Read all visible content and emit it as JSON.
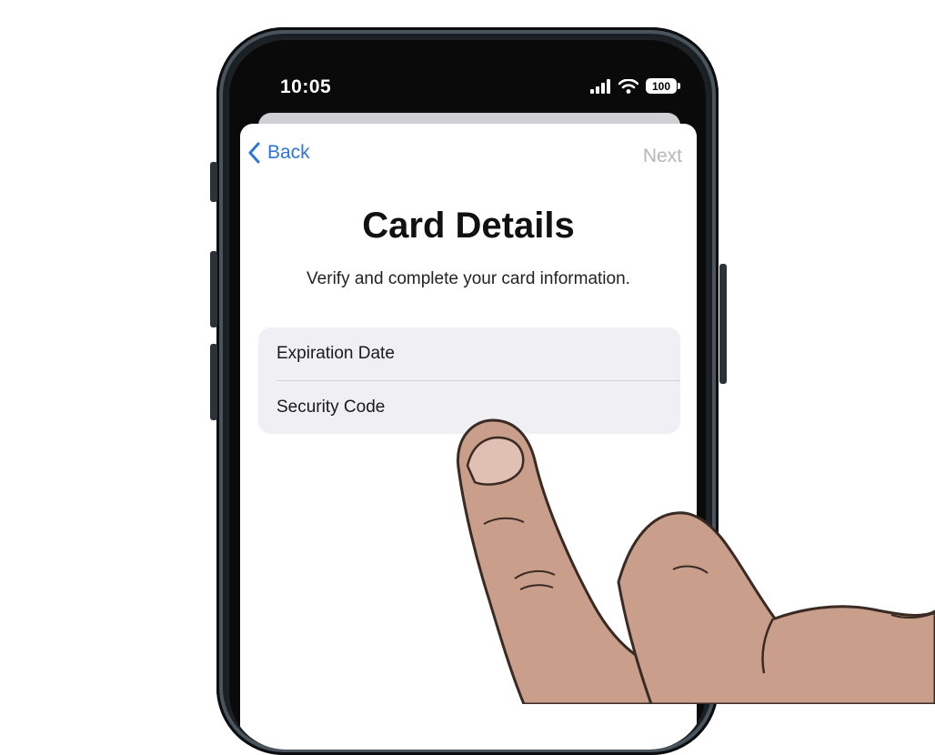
{
  "status_bar": {
    "time": "10:05",
    "battery": "100",
    "icons": [
      "signal-icon",
      "wifi-icon",
      "battery-icon"
    ]
  },
  "nav": {
    "back_label": "Back",
    "next_label": "Next"
  },
  "page": {
    "title": "Card Details",
    "subtitle": "Verify and complete your card information."
  },
  "form": {
    "fields": [
      {
        "label": "Expiration Date"
      },
      {
        "label": "Security Code"
      }
    ]
  },
  "colors": {
    "accent": "#2f74d9",
    "disabled": "#b6b6bb",
    "field_bg": "#f0f0f4"
  }
}
